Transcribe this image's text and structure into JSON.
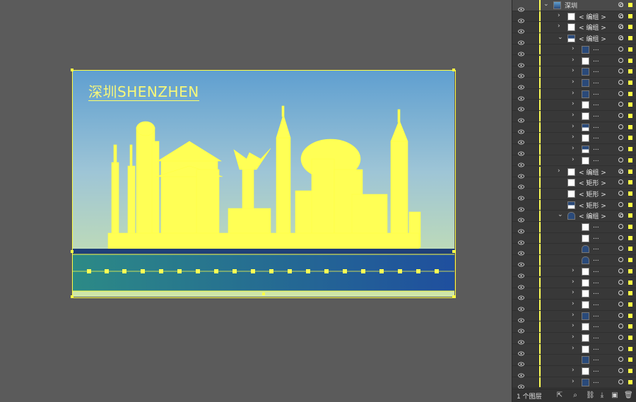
{
  "artboard": {
    "title": "深圳SHENZHEN",
    "sky_top": "#5f9fd0",
    "sky_bottom": "#cfe6a8",
    "selection_color": "#ffff44",
    "road_color": "#2f5f9e",
    "road_light": "#2c8a86"
  },
  "layers": {
    "rows": [
      {
        "label": "深圳",
        "chevron": "down",
        "indent": 0,
        "thumb": "scene",
        "top": true,
        "target": "double"
      },
      {
        "label": "< 编组 >",
        "chevron": "right",
        "indent": 1,
        "thumb": "white",
        "target": "double"
      },
      {
        "label": "< 编组 >",
        "chevron": "right",
        "indent": 1,
        "thumb": "white",
        "target": "double"
      },
      {
        "label": "< 编组 >",
        "chevron": "down",
        "indent": 1,
        "thumb": "mid",
        "target": "double"
      },
      {
        "label": "...",
        "chevron": "right",
        "indent": 2,
        "thumb": "dark",
        "target": "single"
      },
      {
        "label": "...",
        "chevron": "right",
        "indent": 2,
        "thumb": "white",
        "target": "single"
      },
      {
        "label": "...",
        "chevron": "right",
        "indent": 2,
        "thumb": "dark",
        "target": "single"
      },
      {
        "label": "...",
        "chevron": "right",
        "indent": 2,
        "thumb": "dark",
        "target": "single"
      },
      {
        "label": "...",
        "chevron": "right",
        "indent": 2,
        "thumb": "dark",
        "target": "single"
      },
      {
        "label": "...",
        "chevron": "right",
        "indent": 2,
        "thumb": "white",
        "target": "single"
      },
      {
        "label": "...",
        "chevron": "right",
        "indent": 2,
        "thumb": "white",
        "target": "single"
      },
      {
        "label": "...",
        "chevron": "right",
        "indent": 2,
        "thumb": "mid",
        "target": "single"
      },
      {
        "label": "...",
        "chevron": "right",
        "indent": 2,
        "thumb": "white",
        "target": "single"
      },
      {
        "label": "...",
        "chevron": "right",
        "indent": 2,
        "thumb": "mid",
        "target": "single"
      },
      {
        "label": "...",
        "chevron": "right",
        "indent": 2,
        "thumb": "white",
        "target": "single"
      },
      {
        "label": "< 编组 >",
        "chevron": "right",
        "indent": 1,
        "thumb": "white",
        "target": "double"
      },
      {
        "label": "< 矩形 >",
        "chevron": "",
        "indent": 1,
        "thumb": "white",
        "target": "single"
      },
      {
        "label": "< 矩形 >",
        "chevron": "",
        "indent": 1,
        "thumb": "white",
        "target": "single"
      },
      {
        "label": "< 矩形 >",
        "chevron": "",
        "indent": 1,
        "thumb": "mid",
        "target": "single"
      },
      {
        "label": "< 编组 >",
        "chevron": "down",
        "indent": 1,
        "thumb": "cap",
        "target": "double"
      },
      {
        "label": "...",
        "chevron": "",
        "indent": 2,
        "thumb": "white",
        "target": "single"
      },
      {
        "label": "...",
        "chevron": "",
        "indent": 2,
        "thumb": "white",
        "target": "single"
      },
      {
        "label": "...",
        "chevron": "",
        "indent": 2,
        "thumb": "cap",
        "target": "single"
      },
      {
        "label": "...",
        "chevron": "",
        "indent": 2,
        "thumb": "cap",
        "target": "single"
      },
      {
        "label": "...",
        "chevron": "right",
        "indent": 2,
        "thumb": "white",
        "target": "single"
      },
      {
        "label": "...",
        "chevron": "right",
        "indent": 2,
        "thumb": "white",
        "target": "single"
      },
      {
        "label": "...",
        "chevron": "right",
        "indent": 2,
        "thumb": "white",
        "target": "single"
      },
      {
        "label": "...",
        "chevron": "right",
        "indent": 2,
        "thumb": "white",
        "target": "single"
      },
      {
        "label": "...",
        "chevron": "right",
        "indent": 2,
        "thumb": "dark",
        "target": "single"
      },
      {
        "label": "...",
        "chevron": "right",
        "indent": 2,
        "thumb": "white",
        "target": "single"
      },
      {
        "label": "...",
        "chevron": "right",
        "indent": 2,
        "thumb": "white",
        "target": "single"
      },
      {
        "label": "...",
        "chevron": "right",
        "indent": 2,
        "thumb": "white",
        "target": "single"
      },
      {
        "label": "...",
        "chevron": "",
        "indent": 2,
        "thumb": "dark",
        "target": "single"
      },
      {
        "label": "...",
        "chevron": "right",
        "indent": 2,
        "thumb": "white",
        "target": "single"
      },
      {
        "label": "...",
        "chevron": "right",
        "indent": 2,
        "thumb": "dark",
        "target": "single"
      }
    ]
  },
  "footer": {
    "layer_count": "1 个图层",
    "icons": [
      "export-icon",
      "search-icon",
      "link-icon",
      "new-sublayer-icon",
      "new-layer-icon",
      "delete-icon"
    ]
  }
}
